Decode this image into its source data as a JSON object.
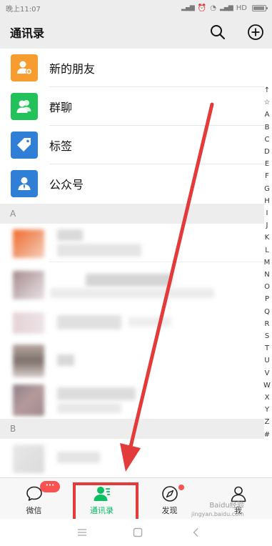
{
  "status_bar": {
    "time": "晚上11:07",
    "network": "HD"
  },
  "header": {
    "title": "通讯录"
  },
  "menu_items": [
    {
      "label": "新的朋友",
      "icon": "add-friend-icon",
      "color": "#f79c2e"
    },
    {
      "label": "群聊",
      "icon": "group-chat-icon",
      "color": "#22c15a"
    },
    {
      "label": "标签",
      "icon": "tag-icon",
      "color": "#2f7fd6"
    },
    {
      "label": "公众号",
      "icon": "official-account-icon",
      "color": "#2f7fd6"
    }
  ],
  "sections": [
    {
      "letter": "A"
    },
    {
      "letter": "B"
    }
  ],
  "index_letters": [
    "↑",
    "☆",
    "A",
    "B",
    "C",
    "D",
    "E",
    "F",
    "G",
    "H",
    "I",
    "J",
    "K",
    "L",
    "M",
    "N",
    "O",
    "P",
    "Q",
    "R",
    "S",
    "T",
    "U",
    "V",
    "W",
    "X",
    "Y",
    "Z",
    "#"
  ],
  "tabs": [
    {
      "label": "微信",
      "icon": "chat-bubble-icon",
      "badge": "···"
    },
    {
      "label": "通讯录",
      "icon": "contacts-icon",
      "active": true
    },
    {
      "label": "发现",
      "icon": "compass-icon"
    },
    {
      "label": "我",
      "icon": "person-icon"
    }
  ],
  "nav_bar": [
    "menu-icon",
    "home-icon",
    "back-icon"
  ],
  "watermark": {
    "line1": "Baidu经验",
    "line2": "jingyan.baidu.com"
  },
  "colors": {
    "accent": "#07c160",
    "annotation": "#e33a3a",
    "badge": "#fa5151"
  }
}
